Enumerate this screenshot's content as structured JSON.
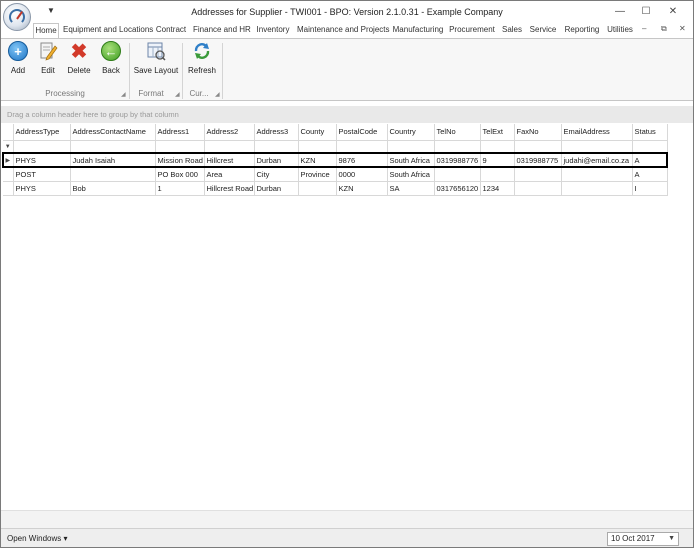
{
  "window": {
    "title": "Addresses for Supplier - TWI001 - BPO: Version 2.1.0.31 - Example Company",
    "minimize": "—",
    "maximize": "☐",
    "close": "✕"
  },
  "tabs": [
    "Home",
    "Equipment and Locations",
    "Contract",
    "Finance and HR",
    "Inventory",
    "Maintenance and Projects",
    "Manufacturing",
    "Procurement",
    "Sales",
    "Service",
    "Reporting",
    "Utilities"
  ],
  "ribbon": {
    "add": "Add",
    "edit": "Edit",
    "delete": "Delete",
    "back": "Back",
    "save_layout": "Save Layout",
    "refresh": "Refresh",
    "group_processing": "Processing",
    "group_format": "Format",
    "group_current": "Cur..."
  },
  "group_panel_hint": "Drag a column header here to group by that column",
  "grid": {
    "columns": [
      "AddressType",
      "AddressContactName",
      "Address1",
      "Address2",
      "Address3",
      "County",
      "PostalCode",
      "Country",
      "TelNo",
      "TelExt",
      "FaxNo",
      "EmailAddress",
      "Status"
    ],
    "rows": [
      [
        "PHYS",
        "Judah Isaiah",
        "Mission Road",
        "Hillcrest",
        "Durban",
        "KZN",
        "9876",
        "South Africa",
        "0319988776",
        "9",
        "0319988775",
        "judahi@email.co.za",
        "A"
      ],
      [
        "POST",
        "",
        "PO Box 000",
        "Area",
        "City",
        "Province",
        "0000",
        "South Africa",
        "",
        "",
        "",
        "",
        "A"
      ],
      [
        "PHYS",
        "Bob",
        "1",
        "Hillcrest Road",
        "Durban",
        "",
        "KZN",
        "SA",
        "0317656120",
        "1234",
        "",
        "",
        "I"
      ]
    ]
  },
  "status": {
    "open_windows": "Open Windows",
    "date": "10 Oct 2017"
  }
}
